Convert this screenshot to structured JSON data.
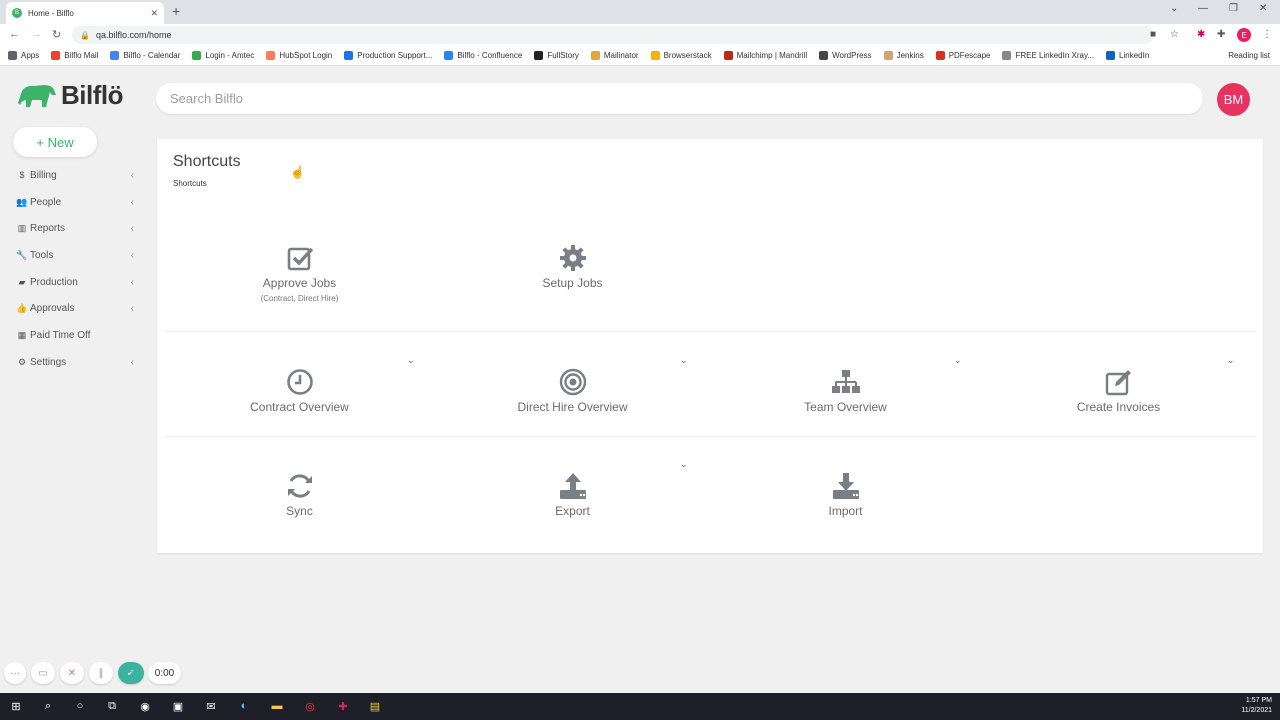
{
  "browser": {
    "tab_title": "Home - Bilflo",
    "url": "qa.bilflo.com/home",
    "profile_initial": "E",
    "bookmarks": [
      {
        "label": "Apps",
        "color": "#5f6368"
      },
      {
        "label": "Bilflo Mail",
        "color": "#ea4335"
      },
      {
        "label": "Bilflo - Calendar",
        "color": "#4285f4"
      },
      {
        "label": "Login - Amtec",
        "color": "#34a853"
      },
      {
        "label": "HubSpot Login",
        "color": "#ff7a59"
      },
      {
        "label": "Production Support...",
        "color": "#1a73e8"
      },
      {
        "label": "Bilflo - Confluence",
        "color": "#2684ff"
      },
      {
        "label": "FullStory",
        "color": "#222222"
      },
      {
        "label": "Mailinator",
        "color": "#e2a63c"
      },
      {
        "label": "Browserstack",
        "color": "#f4b400"
      },
      {
        "label": "Mailchimp | Mandrill",
        "color": "#c5221f"
      },
      {
        "label": "WordPress",
        "color": "#464646"
      },
      {
        "label": "Jenkins",
        "color": "#d4a373"
      },
      {
        "label": "PDFescape",
        "color": "#d93025"
      },
      {
        "label": "FREE LinkedIn Xray...",
        "color": "#888888"
      },
      {
        "label": "LinkedIn",
        "color": "#0a66c2"
      }
    ],
    "reading_list": "Reading list"
  },
  "app": {
    "logo_text": "Bilflö",
    "search_placeholder": "Search Bilflo",
    "user_initials": "BM",
    "new_button": "+ New",
    "brand_color": "#3bb36a"
  },
  "sidebar": {
    "items": [
      {
        "label": "Billing",
        "icon": "$",
        "has_chevron": true
      },
      {
        "label": "People",
        "icon": "users-icon",
        "has_chevron": true
      },
      {
        "label": "Reports",
        "icon": "bar-chart-icon",
        "has_chevron": true
      },
      {
        "label": "Tools",
        "icon": "wrench-icon",
        "has_chevron": true
      },
      {
        "label": "Production",
        "icon": "briefcase-icon",
        "has_chevron": true
      },
      {
        "label": "Approvals",
        "icon": "thumbs-up-icon",
        "has_chevron": true
      },
      {
        "label": "Paid Time Off",
        "icon": "calendar-icon",
        "has_chevron": false
      },
      {
        "label": "Settings",
        "icon": "gear-icon",
        "has_chevron": true
      }
    ]
  },
  "shortcuts": {
    "title": "Shortcuts",
    "breadcrumb": "Shortcuts",
    "items": [
      {
        "label": "Approve Jobs",
        "note": "(Contract, Direct Hire)",
        "icon": "check-square-icon"
      },
      {
        "label": "Setup Jobs",
        "note": "",
        "icon": "gear-icon"
      },
      {
        "label": "Contract Overview",
        "note": "",
        "icon": "clock-icon"
      },
      {
        "label": "Direct Hire Overview",
        "note": "",
        "icon": "target-icon"
      },
      {
        "label": "Team Overview",
        "note": "",
        "icon": "org-chart-icon"
      },
      {
        "label": "Create Invoices",
        "note": "",
        "icon": "edit-icon"
      },
      {
        "label": "Sync",
        "note": "",
        "icon": "sync-icon"
      },
      {
        "label": "Export",
        "note": "",
        "icon": "upload-icon"
      },
      {
        "label": "Import",
        "note": "",
        "icon": "download-icon"
      }
    ]
  },
  "recorder": {
    "timer": "0:00"
  },
  "taskbar": {
    "time": "1:57 PM",
    "date": "11/2/2021"
  }
}
